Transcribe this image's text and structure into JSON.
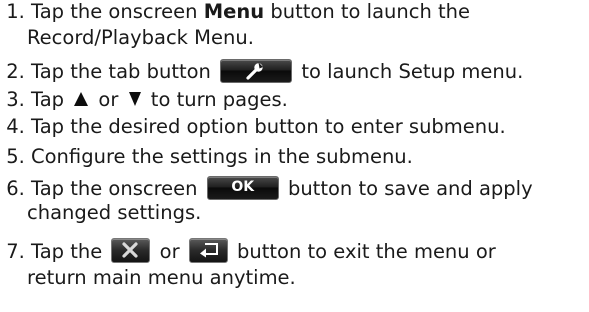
{
  "steps": [
    {
      "num": "1.",
      "a": "Tap the onscreen ",
      "b": "Menu",
      "c": " button to launch the",
      "d": "Record/Playback Menu."
    },
    {
      "num": "2.",
      "a": "Tap the tab button ",
      "b": " to launch Setup menu."
    },
    {
      "num": "3.",
      "a": "Tap ",
      "b": " or ",
      "c": " to turn pages."
    },
    {
      "num": "4.",
      "a": "Tap the desired option button to enter submenu."
    },
    {
      "num": "5.",
      "a": "Configure the settings in the submenu."
    },
    {
      "num": "6.",
      "a": "Tap the onscreen ",
      "b": " button to save and apply",
      "c": "changed settings."
    },
    {
      "num": "7.",
      "a": "Tap the ",
      "b": " or ",
      "c": " button to exit the menu or",
      "d": "return main menu anytime."
    }
  ],
  "buttons": {
    "ok_label": "OK"
  },
  "icons": {
    "setup_tab": "wrench-icon",
    "page_up": "triangle-up-icon",
    "page_down": "triangle-down-icon",
    "exit": "close-icon",
    "return": "return-arrow-icon"
  },
  "colors": {
    "text": "#1a1a1a",
    "button_dark": "#1a1a1a",
    "icon_light": "#ffffff",
    "close_icon": "#d9d9d9"
  }
}
